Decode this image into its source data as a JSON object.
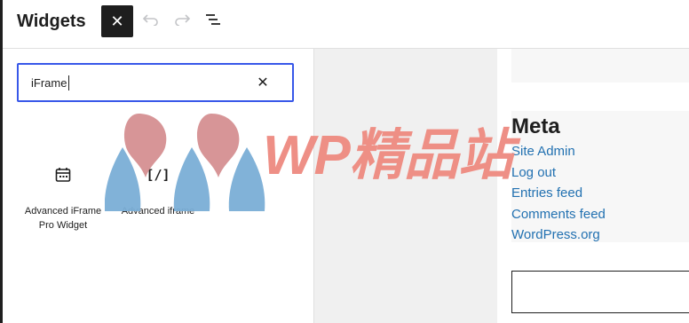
{
  "header": {
    "title": "Widgets",
    "close_icon": "close-icon",
    "undo_icon": "undo-icon",
    "redo_icon": "redo-icon",
    "list_view_icon": "list-view-icon"
  },
  "inserter": {
    "search_value": "iFrame",
    "clear_icon": "close-icon",
    "results": [
      {
        "label": "Advanced iFrame Pro Widget",
        "icon": "calendar-icon"
      },
      {
        "label": "Advanced iframe",
        "icon": "shortcode-icon",
        "icon_text": "[/]"
      }
    ]
  },
  "preview": {
    "meta_title": "Meta",
    "meta_links": [
      "Site Admin",
      "Log out",
      "Entries feed",
      "Comments feed",
      "WordPress.org"
    ]
  },
  "watermark": {
    "text": "WP精品站"
  },
  "colors": {
    "accent": "#3858e9",
    "link": "#2271b1",
    "watermark": "#ee8a80",
    "logo_blue": "#7aaed6",
    "logo_red": "#d38a8c"
  }
}
